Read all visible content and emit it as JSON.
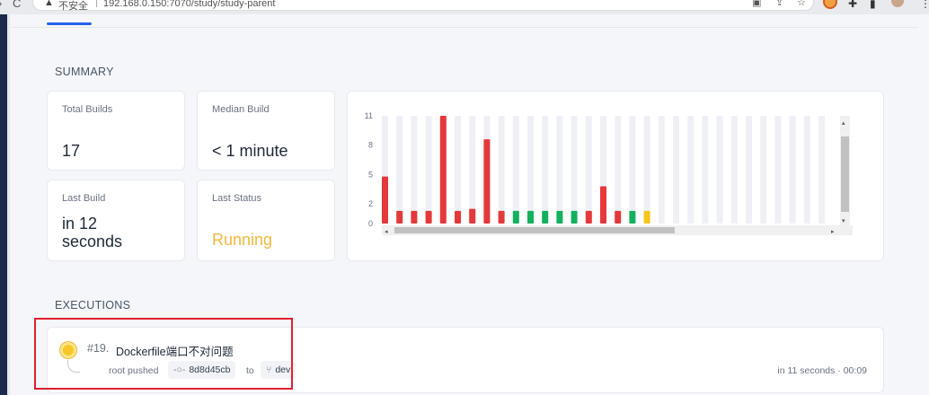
{
  "browser": {
    "insecure_label": "不安全",
    "url": "192.168.0.150:7070/study/study-parent"
  },
  "summary": {
    "title": "SUMMARY",
    "total_builds_label": "Total Builds",
    "total_builds_value": "17",
    "median_build_label": "Median Build",
    "median_build_value": "< 1 minute",
    "last_build_label": "Last Build",
    "last_build_value_line1": "in 12",
    "last_build_value_line2": "seconds",
    "last_status_label": "Last Status",
    "last_status_value": "Running"
  },
  "colors": {
    "failed": "#e5383b",
    "success": "#13b15e",
    "running": "#f5c518",
    "empty": "#eef0f6"
  },
  "chart_data": {
    "type": "bar",
    "y_ticks": [
      "11",
      "8",
      "5",
      "2",
      "0"
    ],
    "ylim": [
      0,
      11
    ],
    "bars": [
      {
        "value": 4.8,
        "status": "failed"
      },
      {
        "value": 1.3,
        "status": "failed"
      },
      {
        "value": 1.3,
        "status": "failed"
      },
      {
        "value": 1.3,
        "status": "failed"
      },
      {
        "value": 11,
        "status": "failed"
      },
      {
        "value": 1.3,
        "status": "failed"
      },
      {
        "value": 1.5,
        "status": "failed"
      },
      {
        "value": 8.6,
        "status": "failed"
      },
      {
        "value": 1.3,
        "status": "failed"
      },
      {
        "value": 1.3,
        "status": "success"
      },
      {
        "value": 1.3,
        "status": "success"
      },
      {
        "value": 1.3,
        "status": "success"
      },
      {
        "value": 1.3,
        "status": "success"
      },
      {
        "value": 1.3,
        "status": "success"
      },
      {
        "value": 1.3,
        "status": "failed"
      },
      {
        "value": 3.8,
        "status": "failed"
      },
      {
        "value": 1.3,
        "status": "failed"
      },
      {
        "value": 1.3,
        "status": "success"
      },
      {
        "value": 1.3,
        "status": "running"
      },
      {
        "value": 0,
        "status": "empty"
      },
      {
        "value": 0,
        "status": "empty"
      },
      {
        "value": 0,
        "status": "empty"
      },
      {
        "value": 0,
        "status": "empty"
      },
      {
        "value": 0,
        "status": "empty"
      },
      {
        "value": 0,
        "status": "empty"
      },
      {
        "value": 0,
        "status": "empty"
      },
      {
        "value": 0,
        "status": "empty"
      },
      {
        "value": 0,
        "status": "empty"
      },
      {
        "value": 0,
        "status": "empty"
      },
      {
        "value": 0,
        "status": "empty"
      },
      {
        "value": 0,
        "status": "empty"
      }
    ],
    "scroll": {
      "horizontal": true,
      "vertical": true
    }
  },
  "executions": {
    "title": "EXECUTIONS",
    "items": [
      {
        "number": "#19.",
        "title": "Dockerfile端口不对问题",
        "author_text": "root pushed",
        "commit": "8d8d45cb",
        "to_text": "to",
        "branch": "dev",
        "relative_time": "in 11 seconds",
        "dot": "·",
        "duration": "00:09",
        "status": "running"
      }
    ]
  }
}
